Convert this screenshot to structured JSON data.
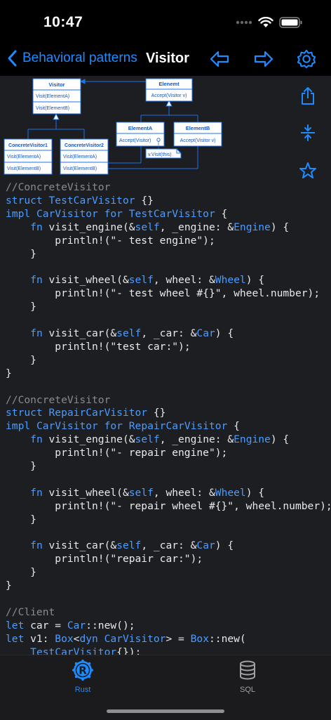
{
  "status": {
    "time": "10:47"
  },
  "nav": {
    "back_label": "Behavioral patterns",
    "title": "Visitor"
  },
  "colors": {
    "accent": "#1e8bff",
    "background": "#1d1e22",
    "comment": "#8a8a8f",
    "keyword": "#4b9cff"
  },
  "diagram": {
    "visitor": {
      "title": "Visitor",
      "methods": [
        "Visit(ElementA)",
        "Visit(ElementB)"
      ]
    },
    "element": {
      "title": "Elenemt",
      "methods": [
        "Accept(Visitor v)"
      ]
    },
    "concrete1": {
      "title": "ConcreteVisitor1",
      "methods": [
        "Visit(ElementA)",
        "Visit(ElementB)"
      ]
    },
    "concrete2": {
      "title": "ConcreteVisitor2",
      "methods": [
        "Visit(ElementA)",
        "Visit(ElementB)"
      ]
    },
    "elementA": {
      "title": "ElementA",
      "methods": [
        "Accept(Visitor)"
      ]
    },
    "elementB": {
      "title": "ElementB",
      "methods": [
        "Accept(Visitor v)"
      ]
    },
    "note": "v.Visit(this)"
  },
  "code_lines": [
    [
      [
        "c",
        "//ConcreteVisitor"
      ]
    ],
    [
      [
        "k",
        "struct "
      ],
      [
        "t",
        "TestCarVisitor"
      ],
      [
        "p",
        " {}"
      ]
    ],
    [
      [
        "k",
        "impl "
      ],
      [
        "t",
        "CarVisitor"
      ],
      [
        "k",
        " for "
      ],
      [
        "t",
        "TestCarVisitor"
      ],
      [
        "p",
        " {"
      ]
    ],
    [
      [
        "p",
        "    "
      ],
      [
        "k",
        "fn"
      ],
      [
        "p",
        " visit_engine(&"
      ],
      [
        "k",
        "self"
      ],
      [
        "p",
        ", _engine: &"
      ],
      [
        "t",
        "Engine"
      ],
      [
        "p",
        ") {"
      ]
    ],
    [
      [
        "p",
        "        println!("
      ],
      [
        "s",
        "\"- test engine\""
      ],
      [
        "p",
        ");"
      ]
    ],
    [
      [
        "p",
        "    }"
      ]
    ],
    [
      [
        "p",
        ""
      ]
    ],
    [
      [
        "p",
        "    "
      ],
      [
        "k",
        "fn"
      ],
      [
        "p",
        " visit_wheel(&"
      ],
      [
        "k",
        "self"
      ],
      [
        "p",
        ", wheel: &"
      ],
      [
        "t",
        "Wheel"
      ],
      [
        "p",
        ") {"
      ]
    ],
    [
      [
        "p",
        "        println!("
      ],
      [
        "s",
        "\"- test wheel #{}\""
      ],
      [
        "p",
        ", wheel.number);"
      ]
    ],
    [
      [
        "p",
        "    }"
      ]
    ],
    [
      [
        "p",
        ""
      ]
    ],
    [
      [
        "p",
        "    "
      ],
      [
        "k",
        "fn"
      ],
      [
        "p",
        " visit_car(&"
      ],
      [
        "k",
        "self"
      ],
      [
        "p",
        ", _car: &"
      ],
      [
        "t",
        "Car"
      ],
      [
        "p",
        ") {"
      ]
    ],
    [
      [
        "p",
        "        println!("
      ],
      [
        "s",
        "\"test car:\""
      ],
      [
        "p",
        ");"
      ]
    ],
    [
      [
        "p",
        "    }"
      ]
    ],
    [
      [
        "p",
        "}"
      ]
    ],
    [
      [
        "p",
        ""
      ]
    ],
    [
      [
        "c",
        "//ConcreteVisitor"
      ]
    ],
    [
      [
        "k",
        "struct "
      ],
      [
        "t",
        "RepairCarVisitor"
      ],
      [
        "p",
        " {}"
      ]
    ],
    [
      [
        "k",
        "impl "
      ],
      [
        "t",
        "CarVisitor"
      ],
      [
        "k",
        " for "
      ],
      [
        "t",
        "RepairCarVisitor"
      ],
      [
        "p",
        " {"
      ]
    ],
    [
      [
        "p",
        "    "
      ],
      [
        "k",
        "fn"
      ],
      [
        "p",
        " visit_engine(&"
      ],
      [
        "k",
        "self"
      ],
      [
        "p",
        ", _engine: &"
      ],
      [
        "t",
        "Engine"
      ],
      [
        "p",
        ") {"
      ]
    ],
    [
      [
        "p",
        "        println!("
      ],
      [
        "s",
        "\"- repair engine\""
      ],
      [
        "p",
        ");"
      ]
    ],
    [
      [
        "p",
        "    }"
      ]
    ],
    [
      [
        "p",
        ""
      ]
    ],
    [
      [
        "p",
        "    "
      ],
      [
        "k",
        "fn"
      ],
      [
        "p",
        " visit_wheel(&"
      ],
      [
        "k",
        "self"
      ],
      [
        "p",
        ", wheel: &"
      ],
      [
        "t",
        "Wheel"
      ],
      [
        "p",
        ") {"
      ]
    ],
    [
      [
        "p",
        "        println!("
      ],
      [
        "s",
        "\"- repair wheel #{}\""
      ],
      [
        "p",
        ", wheel.number);"
      ]
    ],
    [
      [
        "p",
        "    }"
      ]
    ],
    [
      [
        "p",
        ""
      ]
    ],
    [
      [
        "p",
        "    "
      ],
      [
        "k",
        "fn"
      ],
      [
        "p",
        " visit_car(&"
      ],
      [
        "k",
        "self"
      ],
      [
        "p",
        ", _car: &"
      ],
      [
        "t",
        "Car"
      ],
      [
        "p",
        ") {"
      ]
    ],
    [
      [
        "p",
        "        println!("
      ],
      [
        "s",
        "\"repair car:\""
      ],
      [
        "p",
        ");"
      ]
    ],
    [
      [
        "p",
        "    }"
      ]
    ],
    [
      [
        "p",
        "}"
      ]
    ],
    [
      [
        "p",
        ""
      ]
    ],
    [
      [
        "c",
        "//Client"
      ]
    ],
    [
      [
        "k",
        "let"
      ],
      [
        "p",
        " car = "
      ],
      [
        "t",
        "Car"
      ],
      [
        "p",
        "::new();"
      ]
    ],
    [
      [
        "k",
        "let"
      ],
      [
        "p",
        " v1: "
      ],
      [
        "t",
        "Box"
      ],
      [
        "p",
        "<"
      ],
      [
        "k",
        "dyn "
      ],
      [
        "t",
        "CarVisitor"
      ],
      [
        "p",
        "> = "
      ],
      [
        "t",
        "Box"
      ],
      [
        "p",
        "::new("
      ]
    ],
    [
      [
        "p",
        "    "
      ],
      [
        "t",
        "TestCarVisitor"
      ],
      [
        "p",
        "{});"
      ]
    ]
  ],
  "tabs": [
    {
      "label": "Rust",
      "active": true,
      "icon": "rust-logo-icon"
    },
    {
      "label": "SQL",
      "active": false,
      "icon": "database-icon"
    }
  ]
}
